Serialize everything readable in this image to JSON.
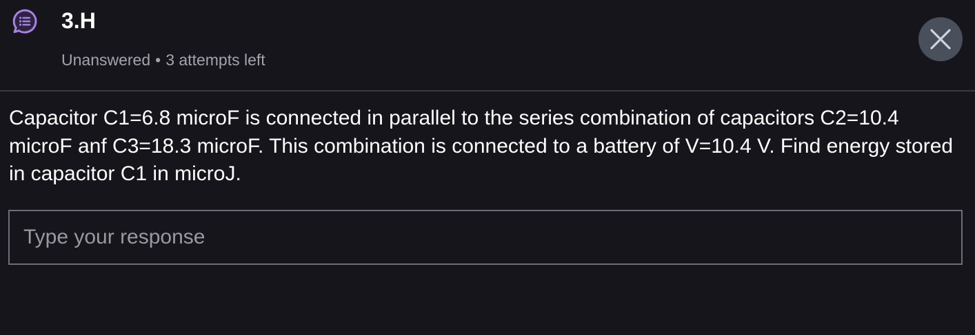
{
  "header": {
    "icon": "question-chat-icon",
    "title": "3.H",
    "status": "Unanswered",
    "separator": "•",
    "attempts": "3 attempts left",
    "close_icon": "close-icon"
  },
  "question": {
    "text": "Capacitor C1=6.8 microF is connected in parallel to the series combination of capacitors C2=10.4 microF anf C3=18.3 microF. This combination is connected to a battery of V=10.4 V. Find energy stored in capacitor C1 in microJ."
  },
  "response": {
    "placeholder": "Type your response",
    "value": ""
  },
  "colors": {
    "background": "#16151b",
    "accent": "#a97fe0",
    "close_button_bg": "#4a4f5c",
    "muted_text": "#a4a3ad"
  }
}
